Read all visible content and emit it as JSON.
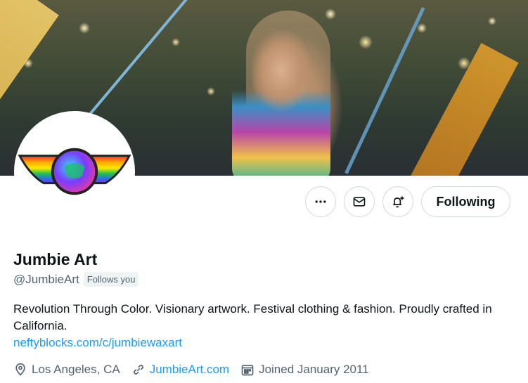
{
  "profile": {
    "name": "Jumbie Art",
    "handle": "@JumbieArt",
    "follows_you": "Follows you",
    "bio": "Revolution Through Color. Visionary artwork. Festival clothing & fashion. Proudly crafted in California.",
    "link": "neftyblocks.com/c/jumbiewaxart",
    "location": "Los Angeles, CA",
    "website": "JumbieArt.com",
    "joined": "Joined January 2011"
  },
  "actions": {
    "more_icon": "more-icon",
    "message_icon": "mail-icon",
    "notify_icon": "bell-plus-icon",
    "follow_label": "Following"
  },
  "colors": {
    "accent": "#1d9bf0",
    "secondary_text": "#536471",
    "primary_text": "#0f1419",
    "border": "#cfd9de"
  }
}
